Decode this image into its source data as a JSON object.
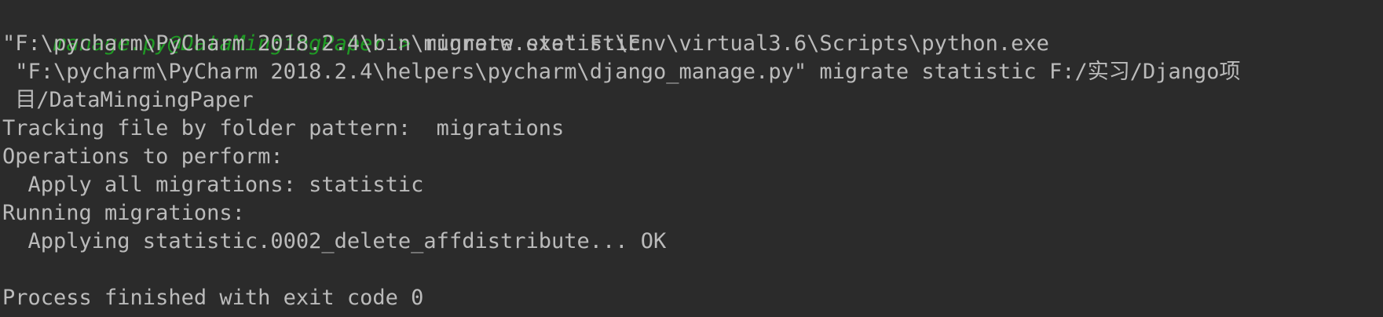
{
  "console": {
    "prompt": "manage.py@DataMingingPaper > ",
    "command": "migrate statistic",
    "lines": [
      "\"F:\\pycharm\\PyCharm 2018.2.4\\bin\\runnerw.exe\" F:\\Env\\virtual3.6\\Scripts\\python.exe",
      " \"F:\\pycharm\\PyCharm 2018.2.4\\helpers\\pycharm\\django_manage.py\" migrate statistic F:/实习/Django项",
      " 目/DataMingingPaper",
      "Tracking file by folder pattern:  migrations",
      "Operations to perform:",
      "  Apply all migrations: statistic",
      "Running migrations:",
      "  Applying statistic.0002_delete_affdistribute... OK",
      "",
      "Process finished with exit code 0"
    ]
  },
  "colors": {
    "background": "#2b2b2b",
    "text": "#bbbbbb",
    "prompt": "#1f9b24"
  }
}
